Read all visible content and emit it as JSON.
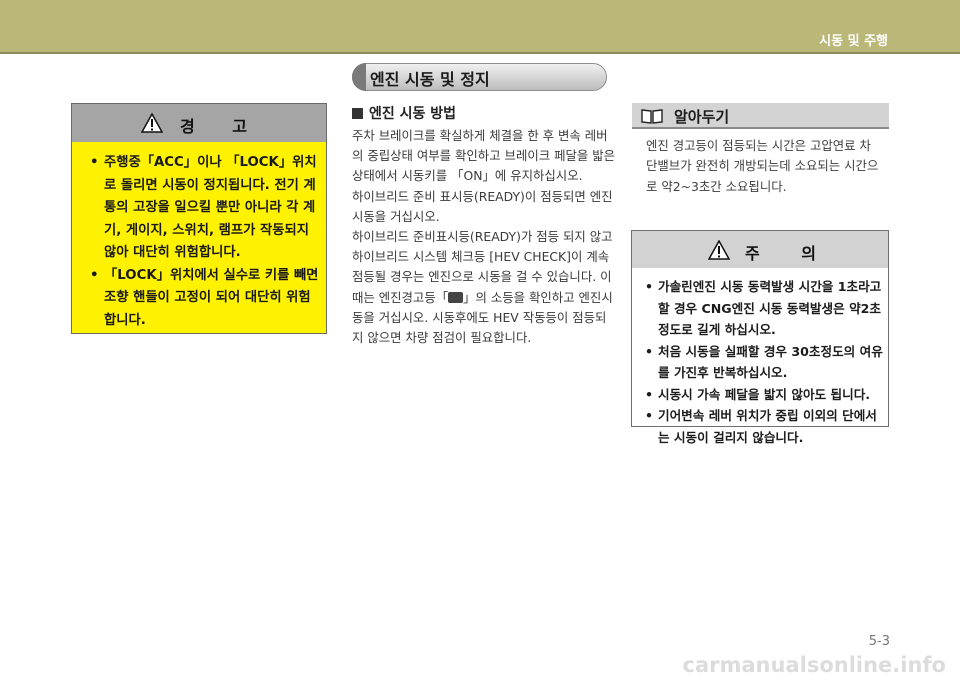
{
  "header": {
    "section": "시동 및 주행"
  },
  "page_title": "엔진 시동 및 정지",
  "warning": {
    "title": "경 고",
    "items": [
      "주행중「ACC」이나 「LOCK」위치로 돌리면 시동이 정지됩니다. 전기 계통의 고장을 일으킬 뿐만 아니라 각 계기, 게이지, 스위치, 램프가 작동되지 않아 대단히 위험합니다.",
      "「LOCK」위치에서 실수로 키를 빼면 조향 핸들이 고정이 되어 대단히 위험합니다."
    ]
  },
  "start_method": {
    "heading": "엔진 시동 방법",
    "paragraphs": [
      "주차 브레이크를 확실하게 체결을 한 후 변속 레버의 중립상태 여부를 확인하고 브레이크 페달을 밟은 상태에서 시동키를 「ON」에 유지하십시오.",
      "하이브리드 준비 표시등(READY)이 점등되면 엔진시동을 거십시오.",
      "하이브리드 준비표시등(READY)가 점등 되지 않고 하이브리드 시스템 체크등 [HEV CHECK]이 계속 점등될 경우는 엔진으로 시동을 걸 수 있습니다. 이때는 엔진경고등「",
      "」의 소등을 확인하고 엔진시동을 거십시오. 시동후에도 HEV 작동등이 점등되지 않으면 차량 점검이 필요합니다."
    ]
  },
  "info": {
    "title": "알아두기",
    "text": "엔진 경고등이 점등되는 시간은 고압연료 차단밸브가 완전히 개방되는데 소요되는 시간으로 약2~3초간 소요됩니다."
  },
  "caution": {
    "title": "주 의",
    "items": [
      "가솔린엔진 시동 동력발생 시간을 1초라고 할 경우 CNG엔진 시동 동력발생은 약2초 정도로 길게 하십시오.",
      "처음 시동을 실패할 경우 30초정도의 여유를 가진후 반복하십시오.",
      "시동시 가속 페달을 밟지 않아도 됩니다.",
      "기어변속 레버 위치가 중립 이외의 단에서는 시동이 걸리지 않습니다."
    ]
  },
  "page_number": "5-3",
  "watermark": "carmanualsonline.info",
  "icons": {
    "warning": "warning-triangle-icon",
    "info": "open-book-icon",
    "engine_check": "engine-check-icon"
  }
}
